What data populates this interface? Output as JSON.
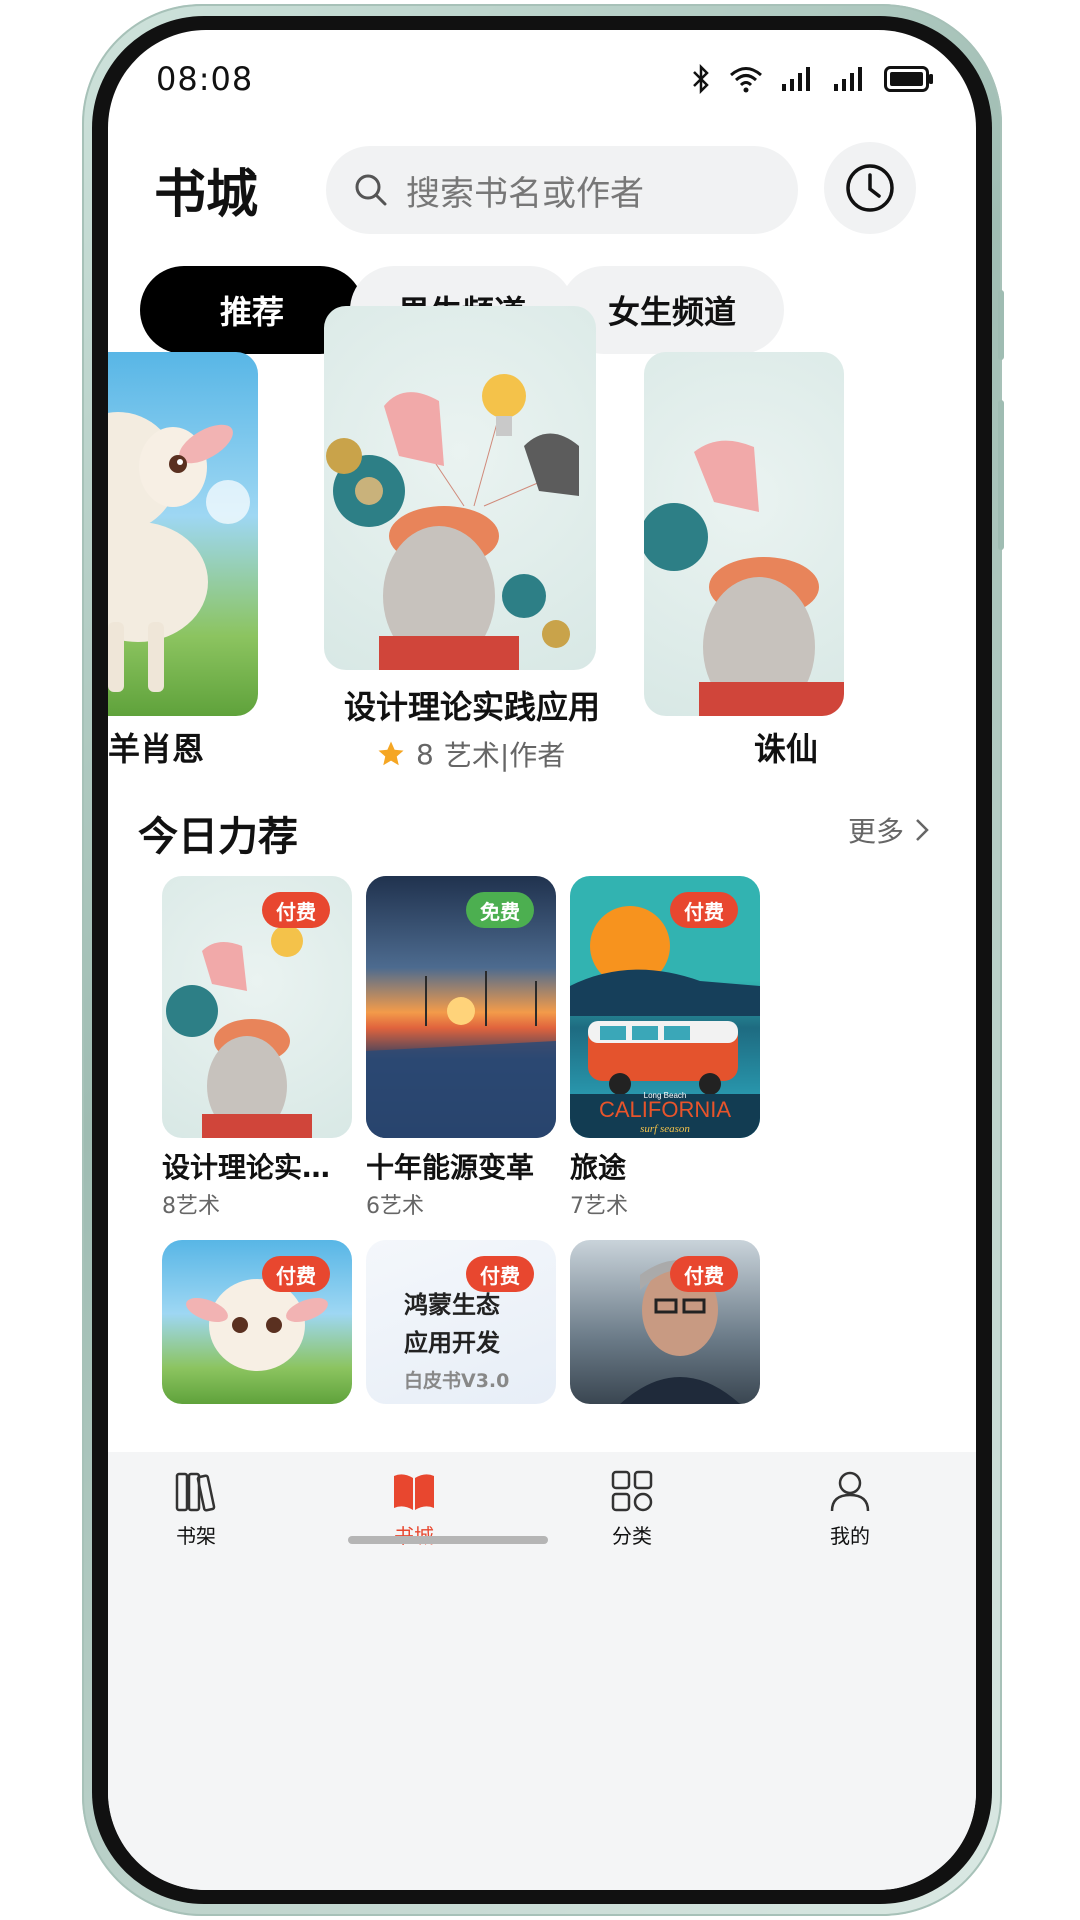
{
  "status_bar": {
    "time": "08:08"
  },
  "header": {
    "title": "书城",
    "search_placeholder": "搜索书名或作者"
  },
  "tabs": [
    {
      "label": "推荐",
      "active": true
    },
    {
      "label": "男生频道",
      "active": false
    },
    {
      "label": "女生频道",
      "active": false
    }
  ],
  "carousel": {
    "left_title": "羊肖恩",
    "center": {
      "title": "设计理论实践应用",
      "rating": "8",
      "author": "艺术|作者"
    },
    "right_title": "诛仙"
  },
  "section": {
    "title": "今日力荐",
    "more": "更多"
  },
  "books": [
    {
      "title": "设计理论实践…",
      "meta": "8艺术",
      "badge": "付费",
      "badge_type": "paid"
    },
    {
      "title": "十年能源变革",
      "meta": "6艺术",
      "badge": "免费",
      "badge_type": "free"
    },
    {
      "title": "旅途",
      "meta": "7艺术",
      "badge": "付费",
      "badge_type": "paid"
    },
    {
      "title": "",
      "meta": "",
      "badge": "付费",
      "badge_type": "paid"
    },
    {
      "title": "",
      "meta": "",
      "badge": "付费",
      "badge_type": "paid"
    },
    {
      "title": "",
      "meta": "",
      "badge": "付费",
      "badge_type": "paid"
    }
  ],
  "cover_texts": {
    "cali_small": "Long Beach",
    "cali_big": "CALIFORNIA",
    "cali_sub": "surf season",
    "white_line1": "鸿蒙生态",
    "white_line2": "应用开发",
    "white_line3": "白皮书V3.0"
  },
  "bottom_nav": [
    {
      "label": "书架",
      "icon": "bookshelf-icon"
    },
    {
      "label": "书城",
      "icon": "open-book-icon",
      "active": true
    },
    {
      "label": "分类",
      "icon": "grid-icon"
    },
    {
      "label": "我的",
      "icon": "person-icon"
    }
  ],
  "colors": {
    "accent": "#e8472f",
    "free": "#4caf50",
    "tab_active": "#000000"
  }
}
